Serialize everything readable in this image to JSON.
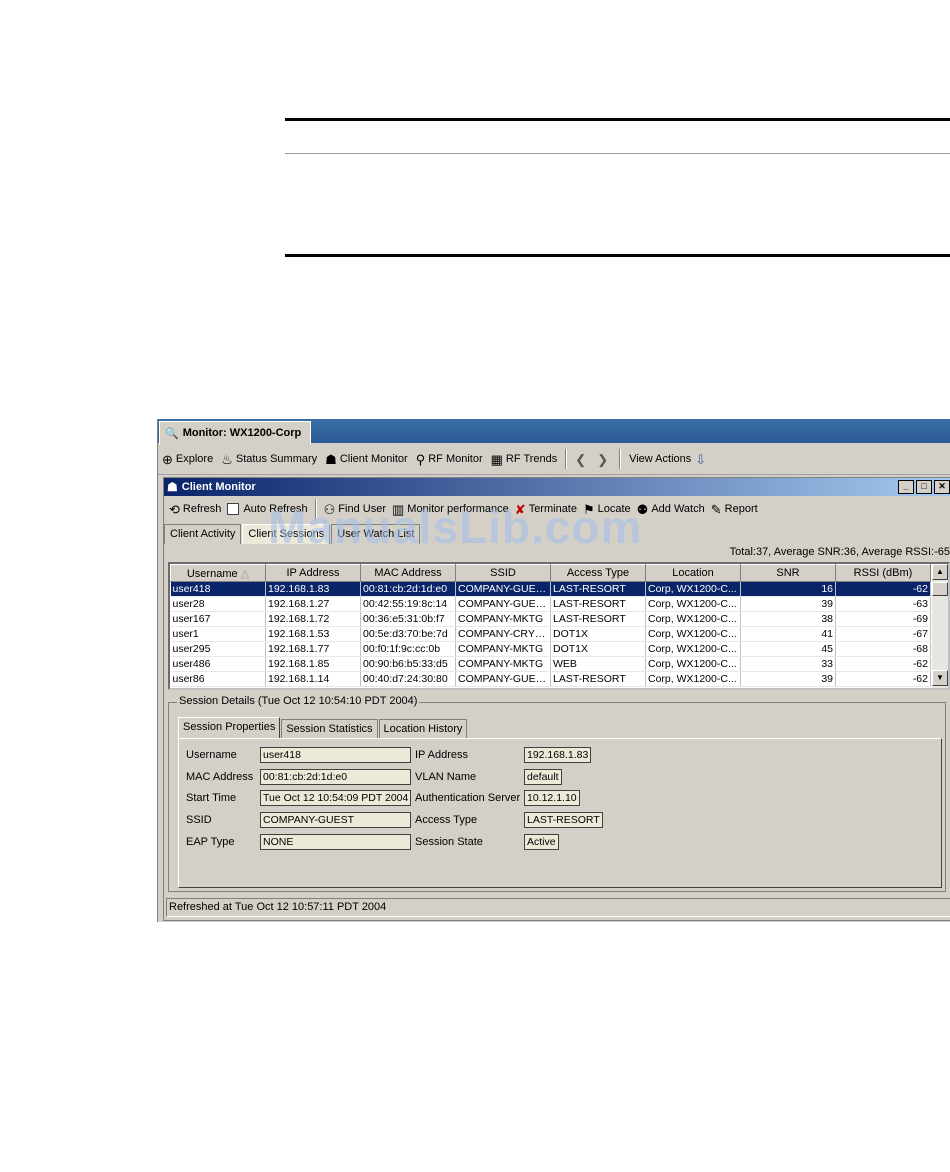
{
  "window_tab": {
    "title": "Monitor: WX1200-Corp"
  },
  "main_toolbar": {
    "explore": "Explore",
    "status_summary": "Status Summary",
    "client_monitor": "Client Monitor",
    "rf_monitor": "RF Monitor",
    "rf_trends": "RF Trends",
    "view_actions": "View Actions"
  },
  "client_monitor": {
    "title": "Client Monitor",
    "toolbar": {
      "refresh": "Refresh",
      "auto_refresh": "Auto Refresh",
      "find_user": "Find User",
      "monitor_performance": "Monitor performance",
      "terminate": "Terminate",
      "locate": "Locate",
      "add_watch": "Add Watch",
      "report": "Report"
    },
    "tabs": [
      "Client Activity",
      "Client Sessions",
      "User Watch List"
    ],
    "totals": "Total:37, Average SNR:36, Average RSSI:-65",
    "columns": [
      "Username",
      "IP Address",
      "MAC Address",
      "SSID",
      "Access Type",
      "Location",
      "SNR",
      "RSSI (dBm)"
    ],
    "rows": [
      [
        "user418",
        "192.168.1.83",
        "00:81:cb:2d:1d:e0",
        "COMPANY-GUEST",
        "LAST-RESORT",
        "Corp, WX1200-C...",
        "16",
        "-62"
      ],
      [
        "user28",
        "192.168.1.27",
        "00:42:55:19:8c:14",
        "COMPANY-GUEST",
        "LAST-RESORT",
        "Corp, WX1200-C...",
        "39",
        "-63"
      ],
      [
        "user167",
        "192.168.1.72",
        "00:36:e5:31:0b:f7",
        "COMPANY-MKTG",
        "LAST-RESORT",
        "Corp, WX1200-C...",
        "38",
        "-69"
      ],
      [
        "user1",
        "192.168.1.53",
        "00:5e:d3:70:be:7d",
        "COMPANY-CRYP...",
        "DOT1X",
        "Corp, WX1200-C...",
        "41",
        "-67"
      ],
      [
        "user295",
        "192.168.1.77",
        "00:f0:1f:9c:cc:0b",
        "COMPANY-MKTG",
        "DOT1X",
        "Corp, WX1200-C...",
        "45",
        "-68"
      ],
      [
        "user486",
        "192.168.1.85",
        "00:90:b6:b5:33:d5",
        "COMPANY-MKTG",
        "WEB",
        "Corp, WX1200-C...",
        "33",
        "-62"
      ],
      [
        "user86",
        "192.168.1.14",
        "00:40:d7:24:30:80",
        "COMPANY-GUEST",
        "LAST-RESORT",
        "Corp, WX1200-C...",
        "39",
        "-62"
      ]
    ],
    "session_details": {
      "legend": "Session Details (Tue Oct 12 10:54:10 PDT 2004)",
      "tabs": [
        "Session Properties",
        "Session Statistics",
        "Location History"
      ],
      "fields": {
        "username_label": "Username",
        "username": "user418",
        "mac_label": "MAC Address",
        "mac": "00:81:cb:2d:1d:e0",
        "start_label": "Start Time",
        "start": "Tue Oct 12 10:54:09 PDT 2004",
        "ssid_label": "SSID",
        "ssid": "COMPANY-GUEST",
        "eap_label": "EAP Type",
        "eap": "NONE",
        "ip_label": "IP Address",
        "ip": "192.168.1.83",
        "vlan_label": "VLAN Name",
        "vlan": "default",
        "auth_label": "Authentication Server",
        "auth": "10.12.1.10",
        "access_label": "Access Type",
        "access": "LAST-RESORT",
        "state_label": "Session State",
        "state": "Active"
      }
    },
    "status": "Refreshed at Tue Oct 12 10:57:11 PDT 2004"
  },
  "watermark": "ManualsLib.com"
}
